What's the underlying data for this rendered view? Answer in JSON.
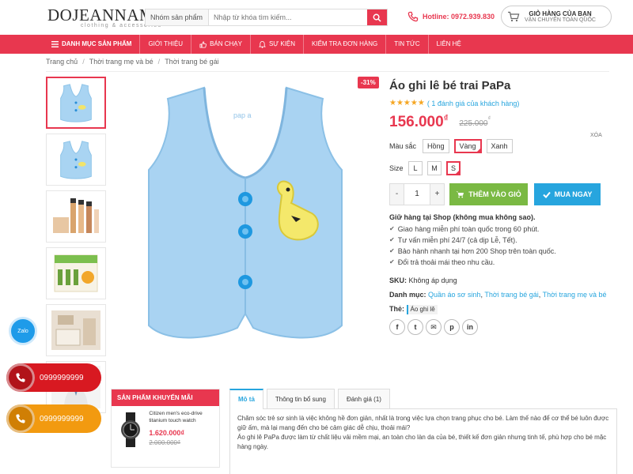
{
  "header": {
    "logo_main": "DOJEANNAM",
    "logo_sub": "clothing & accessories",
    "search_category": "Nhóm sản phẩm",
    "search_placeholder": "Nhập từ khóa tìm kiếm...",
    "hotline": "Hotline: 0972.939.830",
    "cart_title": "GIỎ HÀNG CỦA BẠN",
    "cart_sub": "VẬN CHUYỂN TOÀN QUỐC"
  },
  "nav": {
    "items": [
      {
        "label": "DANH MỤC SẢN PHẨM",
        "icon": "menu-icon"
      },
      {
        "label": "GIỚI THIỆU"
      },
      {
        "label": "BÁN CHẠY",
        "icon": "thumbs-up-icon"
      },
      {
        "label": "SỰ KIỆN",
        "icon": "bell-icon"
      },
      {
        "label": "KIỂM TRA ĐƠN HÀNG"
      },
      {
        "label": "TIN TỨC"
      },
      {
        "label": "LIÊN HỆ"
      }
    ]
  },
  "breadcrumb": [
    "Trang chủ",
    "Thời trang mẹ và bé",
    "Thời trang bé gái"
  ],
  "product": {
    "sale_badge": "-31%",
    "title": "Áo ghi lê bé trai PaPa",
    "stars": "★★★★★",
    "rating_text": "( 1 đánh giá của khách hàng)",
    "price": "156.000",
    "currency": "₫",
    "old_price": "225.000",
    "clear_label": "XÓA",
    "color_label": "Màu sắc",
    "colors": [
      {
        "label": "Hồng",
        "selected": false
      },
      {
        "label": "Vàng",
        "selected": true
      },
      {
        "label": "Xanh",
        "selected": false
      }
    ],
    "size_label": "Size",
    "sizes": [
      {
        "label": "L",
        "selected": false
      },
      {
        "label": "M",
        "selected": false
      },
      {
        "label": "S",
        "selected": true
      }
    ],
    "qty_minus": "-",
    "qty_value": "1",
    "qty_plus": "+",
    "add_to_cart": "THÊM VÀO GIỎ",
    "buy_now": "MUA NGAY",
    "guarantee_title": "Giữ hàng tại Shop (không mua không sao).",
    "guarantees": [
      "Giao hàng miễn phí toàn quốc trong 60 phút.",
      "Tư vấn miễn phí 24/7 (cả dịp Lễ, Tết).",
      "Bảo hành nhanh tại hơn 200 Shop trên toàn quốc.",
      "Đổi trả thoải mái theo nhu cầu."
    ],
    "sku_label": "SKU:",
    "sku_value": "Không áp dụng",
    "category_label": "Danh mục:",
    "categories": [
      "Quần áo sơ sinh",
      "Thời trang bé gái",
      "Thời trang mẹ và bé"
    ],
    "tag_label": "Thẻ:",
    "tag_value": "Áo ghi lê",
    "share": [
      "f",
      "t",
      "✉",
      "p",
      "in"
    ]
  },
  "contacts": {
    "zalo": "Zalo",
    "phone1": "0999999999",
    "phone2": "0999999999"
  },
  "promo": {
    "title": "SẢN PHẨM KHUYẾN MÃI",
    "item_name": "Citizen men's eco-drive titanium touch watch",
    "item_price": "1.620.000₫",
    "item_old_price": "2.000.000₫"
  },
  "tabs": {
    "items": [
      {
        "label": "Mô tả",
        "active": true
      },
      {
        "label": "Thông tin bổ sung",
        "active": false
      },
      {
        "label": "Đánh giá (1)",
        "active": false
      }
    ],
    "description_1": "Chăm sóc trẻ sơ sinh là việc không hề đơn giản, nhất là trong việc lựa chọn trang phục cho bé. Làm thế nào để cơ thể bé luôn được giữ ấm, mà lại mang đến cho bé cảm giác dễ chịu, thoải mái?",
    "description_2": "Áo ghi lê PaPa được làm từ chất liệu vải mềm mại, an toàn cho làn da của bé, thiết kế đơn giản nhưng tinh tế, phù hợp cho bé mặc hàng ngày."
  },
  "colors": {
    "brand": "#e8374f",
    "link": "#27a5de",
    "add_cart": "#7ab943",
    "buy_now": "#27a5de",
    "star": "#f5a623"
  }
}
